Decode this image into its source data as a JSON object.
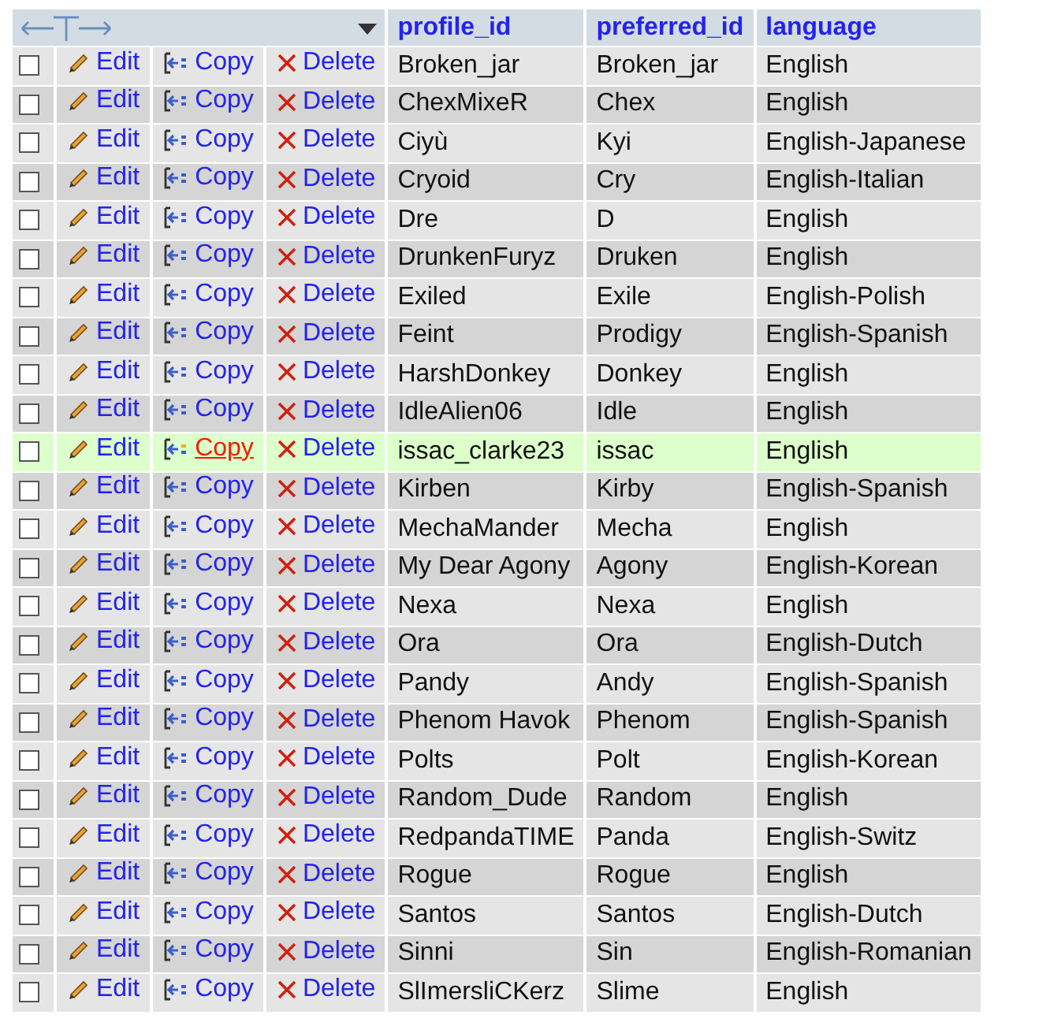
{
  "table": {
    "columns": [
      "profile_id",
      "preferred_id",
      "language"
    ],
    "rows": [
      {
        "edit": "Edit",
        "copy": "Copy",
        "delete": "Delete",
        "profile_id": "Broken_jar",
        "preferred_id": "Broken_jar",
        "language": "English",
        "checked": false,
        "hovered": false
      },
      {
        "edit": "Edit",
        "copy": "Copy",
        "delete": "Delete",
        "profile_id": "ChexMixeR",
        "preferred_id": "Chex",
        "language": "English",
        "checked": false,
        "hovered": false
      },
      {
        "edit": "Edit",
        "copy": "Copy",
        "delete": "Delete",
        "profile_id": "Ciyù",
        "preferred_id": "Kyi",
        "language": "English-Japanese",
        "checked": false,
        "hovered": false
      },
      {
        "edit": "Edit",
        "copy": "Copy",
        "delete": "Delete",
        "profile_id": "Cryoid",
        "preferred_id": "Cry",
        "language": "English-Italian",
        "checked": false,
        "hovered": false
      },
      {
        "edit": "Edit",
        "copy": "Copy",
        "delete": "Delete",
        "profile_id": "Dre",
        "preferred_id": "D",
        "language": "English",
        "checked": false,
        "hovered": false
      },
      {
        "edit": "Edit",
        "copy": "Copy",
        "delete": "Delete",
        "profile_id": "DrunkenFuryz",
        "preferred_id": "Druken",
        "language": "English",
        "checked": false,
        "hovered": false
      },
      {
        "edit": "Edit",
        "copy": "Copy",
        "delete": "Delete",
        "profile_id": "Exiled",
        "preferred_id": "Exile",
        "language": "English-Polish",
        "checked": false,
        "hovered": false
      },
      {
        "edit": "Edit",
        "copy": "Copy",
        "delete": "Delete",
        "profile_id": "Feint",
        "preferred_id": "Prodigy",
        "language": "English-Spanish",
        "checked": false,
        "hovered": false
      },
      {
        "edit": "Edit",
        "copy": "Copy",
        "delete": "Delete",
        "profile_id": "HarshDonkey",
        "preferred_id": "Donkey",
        "language": "English",
        "checked": false,
        "hovered": false
      },
      {
        "edit": "Edit",
        "copy": "Copy",
        "delete": "Delete",
        "profile_id": "IdleAlien06",
        "preferred_id": "Idle",
        "language": "English",
        "checked": false,
        "hovered": false
      },
      {
        "edit": "Edit",
        "copy": "Copy",
        "delete": "Delete",
        "profile_id": "issac_clarke23",
        "preferred_id": "issac",
        "language": "English",
        "checked": false,
        "hovered": true
      },
      {
        "edit": "Edit",
        "copy": "Copy",
        "delete": "Delete",
        "profile_id": "Kirben",
        "preferred_id": "Kirby",
        "language": "English-Spanish",
        "checked": false,
        "hovered": false
      },
      {
        "edit": "Edit",
        "copy": "Copy",
        "delete": "Delete",
        "profile_id": "MechaMander",
        "preferred_id": "Mecha",
        "language": "English",
        "checked": false,
        "hovered": false
      },
      {
        "edit": "Edit",
        "copy": "Copy",
        "delete": "Delete",
        "profile_id": "My Dear Agony",
        "preferred_id": "Agony",
        "language": "English-Korean",
        "checked": false,
        "hovered": false
      },
      {
        "edit": "Edit",
        "copy": "Copy",
        "delete": "Delete",
        "profile_id": "Nexa",
        "preferred_id": "Nexa",
        "language": "English",
        "checked": false,
        "hovered": false
      },
      {
        "edit": "Edit",
        "copy": "Copy",
        "delete": "Delete",
        "profile_id": "Ora",
        "preferred_id": "Ora",
        "language": "English-Dutch",
        "checked": false,
        "hovered": false
      },
      {
        "edit": "Edit",
        "copy": "Copy",
        "delete": "Delete",
        "profile_id": "Pandy",
        "preferred_id": "Andy",
        "language": "English-Spanish",
        "checked": false,
        "hovered": false
      },
      {
        "edit": "Edit",
        "copy": "Copy",
        "delete": "Delete",
        "profile_id": "Phenom Havok",
        "preferred_id": "Phenom",
        "language": "English-Spanish",
        "checked": false,
        "hovered": false
      },
      {
        "edit": "Edit",
        "copy": "Copy",
        "delete": "Delete",
        "profile_id": "Polts",
        "preferred_id": "Polt",
        "language": "English-Korean",
        "checked": false,
        "hovered": false
      },
      {
        "edit": "Edit",
        "copy": "Copy",
        "delete": "Delete",
        "profile_id": "Random_Dude",
        "preferred_id": "Random",
        "language": "English",
        "checked": false,
        "hovered": false
      },
      {
        "edit": "Edit",
        "copy": "Copy",
        "delete": "Delete",
        "profile_id": "RedpandaTIME",
        "preferred_id": "Panda",
        "language": "English-Switz",
        "checked": false,
        "hovered": false
      },
      {
        "edit": "Edit",
        "copy": "Copy",
        "delete": "Delete",
        "profile_id": "Rogue",
        "preferred_id": "Rogue",
        "language": "English",
        "checked": false,
        "hovered": false
      },
      {
        "edit": "Edit",
        "copy": "Copy",
        "delete": "Delete",
        "profile_id": "Santos",
        "preferred_id": "Santos",
        "language": "English-Dutch",
        "checked": false,
        "hovered": false
      },
      {
        "edit": "Edit",
        "copy": "Copy",
        "delete": "Delete",
        "profile_id": "Sinni",
        "preferred_id": "Sin",
        "language": "English-Romanian",
        "checked": false,
        "hovered": false
      },
      {
        "edit": "Edit",
        "copy": "Copy",
        "delete": "Delete",
        "profile_id": "SlImersliCKerz",
        "preferred_id": "Slime",
        "language": "English",
        "checked": false,
        "hovered": false
      }
    ]
  }
}
